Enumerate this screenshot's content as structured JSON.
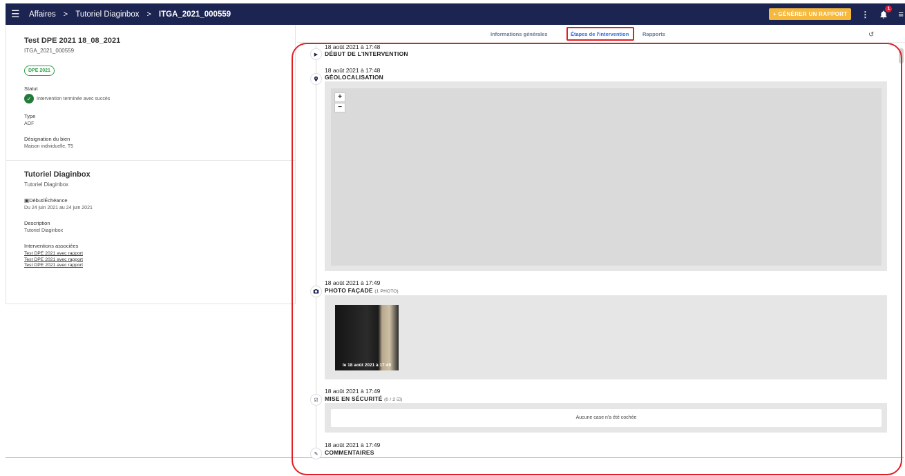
{
  "topbar": {
    "breadcrumb": [
      "Affaires",
      "Tutoriel Diaginbox",
      "ITGA_2021_000559"
    ],
    "separator": ">",
    "generate_label": "+ GÉNÉRER UN RAPPORT",
    "notification_count": "1",
    "colors": {
      "bar": "#1c2451",
      "button": "#f6b93b",
      "badge": "#e0203a"
    }
  },
  "intervention": {
    "title": "Test DPE 2021 18_08_2021",
    "code": "ITGA_2021_000559",
    "chip": "DPE 2021",
    "status_label": "Statut",
    "status_value": "Intervention terminée avec succès",
    "type_label": "Type",
    "type_value": "AOF",
    "designation_label": "Désignation du bien",
    "designation_value": "Maison individuelle, T5"
  },
  "affaire": {
    "title": "Tutoriel Diaginbox",
    "subtitle": "Tutoriel Diaginbox",
    "dates_label": "Début/Échéance",
    "dates_value": "Du 24 juin 2021 au 24 juin 2021",
    "description_label": "Description",
    "description_value": "Tutoriel Diaginbox",
    "associated_label": "Interventions associées",
    "associated": [
      "Test DPE 2021 avec rapport",
      "Test DPE 2021 avec rapport",
      "Test DPE 2021 avec rapport"
    ]
  },
  "tabs": [
    {
      "label": "Informations générales"
    },
    {
      "label": "Étapes de l'intervention",
      "active": true
    },
    {
      "label": "Rapports"
    }
  ],
  "steps": [
    {
      "date": "18 août 2021 à 17:48",
      "title": "DÉBUT DE L'INTERVENTION",
      "icon": "play-icon"
    },
    {
      "date": "18 août 2021 à 17:48",
      "title": "GÉOLOCALISATION",
      "icon": "location-pin-icon"
    },
    {
      "date": "18 août 2021 à 17:49",
      "title": "PHOTO FAÇADE",
      "note": "(1 PHOTO)",
      "icon": "camera-icon",
      "photo_caption": "le 18 août 2021 à 17:49"
    },
    {
      "date": "18 août 2021 à 17:49",
      "title": "MISE EN SÉCURITÉ",
      "note": "(0 / 2 ☑)",
      "icon": "checklist-icon",
      "empty_text": "Aucune case n'a été cochée"
    },
    {
      "date": "18 août 2021 à 17:49",
      "title": "COMMENTAIRES",
      "icon": "pencil-icon"
    }
  ],
  "map": {
    "zoom_in": "+",
    "zoom_out": "−"
  }
}
